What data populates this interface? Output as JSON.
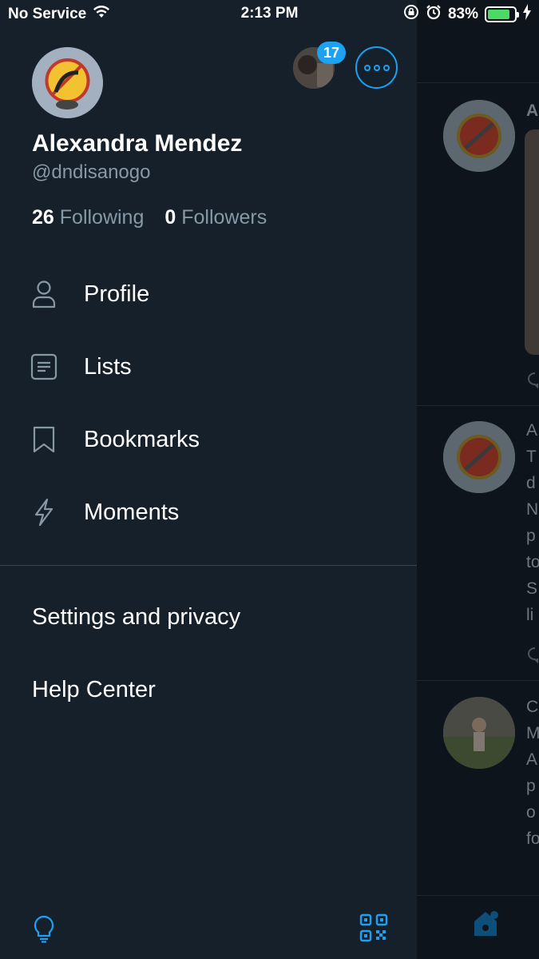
{
  "status": {
    "carrier": "No Service",
    "time": "2:13 PM",
    "battery": "83%",
    "battery_level": 0.83
  },
  "drawer": {
    "name": "Alexandra Mendez",
    "handle": "@dndisanogo",
    "following_count": "26",
    "following_label": "Following",
    "followers_count": "0",
    "followers_label": "Followers",
    "badge_count": "17",
    "menu": [
      {
        "label": "Profile",
        "icon": "person-icon"
      },
      {
        "label": "Lists",
        "icon": "list-icon"
      },
      {
        "label": "Bookmarks",
        "icon": "bookmark-icon"
      },
      {
        "label": "Moments",
        "icon": "lightning-icon"
      }
    ],
    "settings_label": "Settings and privacy",
    "help_label": "Help Center"
  },
  "timeline": {
    "row1_initial": "A",
    "row2_lines": "A\nT\nd\nN\np\nto\nS\nli",
    "row3_lines": "C\nM\nA\np\no\nfo"
  },
  "colors": {
    "accent": "#1da1f2",
    "drawer_bg": "#15202b",
    "secondary_text": "#8899a6"
  }
}
